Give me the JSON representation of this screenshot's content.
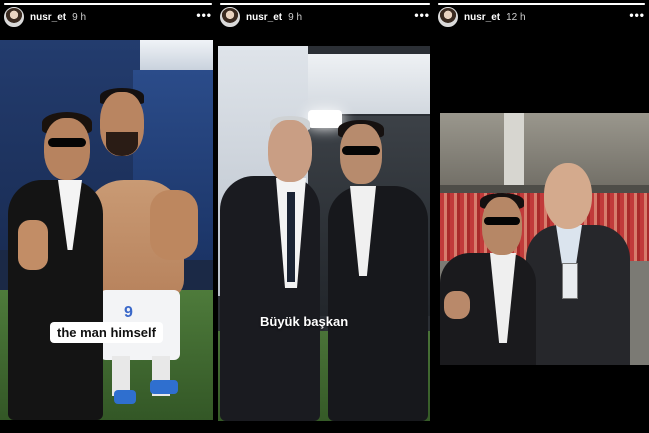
{
  "stories": [
    {
      "username": "nusr_et",
      "time": "9 h",
      "more": "•••",
      "caption": "the man himself",
      "progress": 1.0
    },
    {
      "username": "nusr_et",
      "time": "9 h",
      "more": "•••",
      "caption": "Büyük başkan",
      "progress": 1.0
    },
    {
      "username": "nusr_et",
      "time": "12 h",
      "more": "•••",
      "caption": "",
      "progress": 1.0
    }
  ]
}
